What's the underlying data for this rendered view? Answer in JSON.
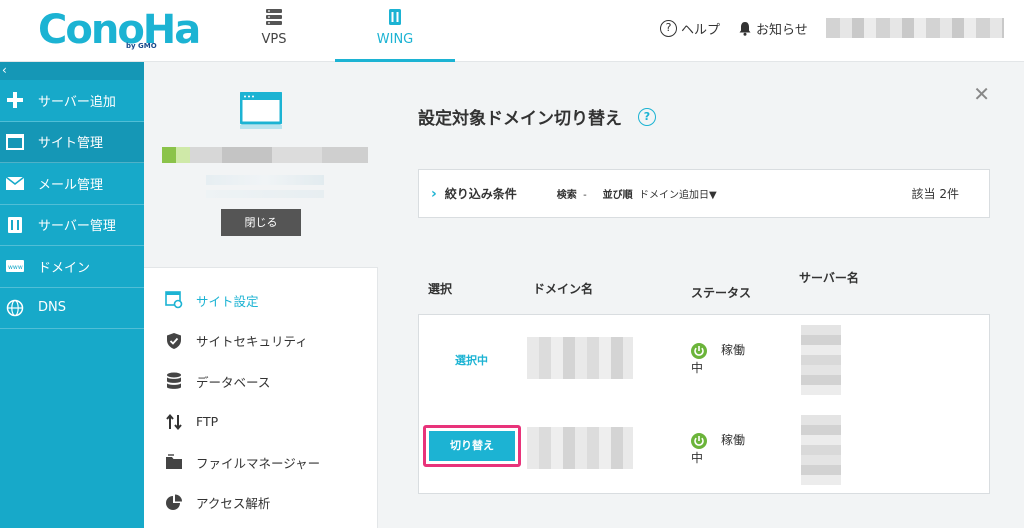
{
  "header": {
    "logo_text": "ConoHa",
    "logo_sub": "by GMO",
    "tabs": [
      {
        "label": "VPS",
        "icon": "server-icon",
        "active": false
      },
      {
        "label": "WING",
        "icon": "wing-icon",
        "active": true
      }
    ],
    "help_label": "ヘルプ",
    "notice_label": "お知らせ",
    "accent_color": "#1cb3d3"
  },
  "sidebar": {
    "collapse_glyph": "‹",
    "items": [
      {
        "label": "サーバー追加",
        "icon": "plus-icon",
        "active": false
      },
      {
        "label": "サイト管理",
        "icon": "window-icon",
        "active": true
      },
      {
        "label": "メール管理",
        "icon": "mail-icon",
        "active": false
      },
      {
        "label": "サーバー管理",
        "icon": "server-manage-icon",
        "active": false
      },
      {
        "label": "ドメイン",
        "icon": "domain-icon",
        "active": false
      },
      {
        "label": "DNS",
        "icon": "globe-icon",
        "active": false
      }
    ]
  },
  "site_panel": {
    "close_label": "閉じる"
  },
  "menu": {
    "items": [
      {
        "label": "サイト設定",
        "icon": "site-settings-icon",
        "active": true
      },
      {
        "label": "サイトセキュリティ",
        "icon": "shield-icon",
        "active": false
      },
      {
        "label": "データベース",
        "icon": "database-icon",
        "active": false
      },
      {
        "label": "FTP",
        "icon": "ftp-icon",
        "active": false
      },
      {
        "label": "ファイルマネージャー",
        "icon": "folder-icon",
        "active": false
      },
      {
        "label": "アクセス解析",
        "icon": "pie-chart-icon",
        "active": false
      }
    ]
  },
  "main": {
    "title": "設定対象ドメイン切り替え",
    "close_glyph": "✕",
    "filter": {
      "label": "絞り込み条件",
      "search_label": "検索",
      "search_value": "-",
      "sort_label": "並び順",
      "sort_value": "ドメイン追加日▼",
      "count_text": "該当 2件"
    },
    "columns": {
      "select": "選択",
      "domain": "ドメイン名",
      "status": "ステータス",
      "server": "サーバー名"
    },
    "rows": [
      {
        "select_text": "選択中",
        "status_text": "稼働中"
      },
      {
        "switch_label": "切り替え",
        "status_text": "稼働中"
      }
    ]
  }
}
